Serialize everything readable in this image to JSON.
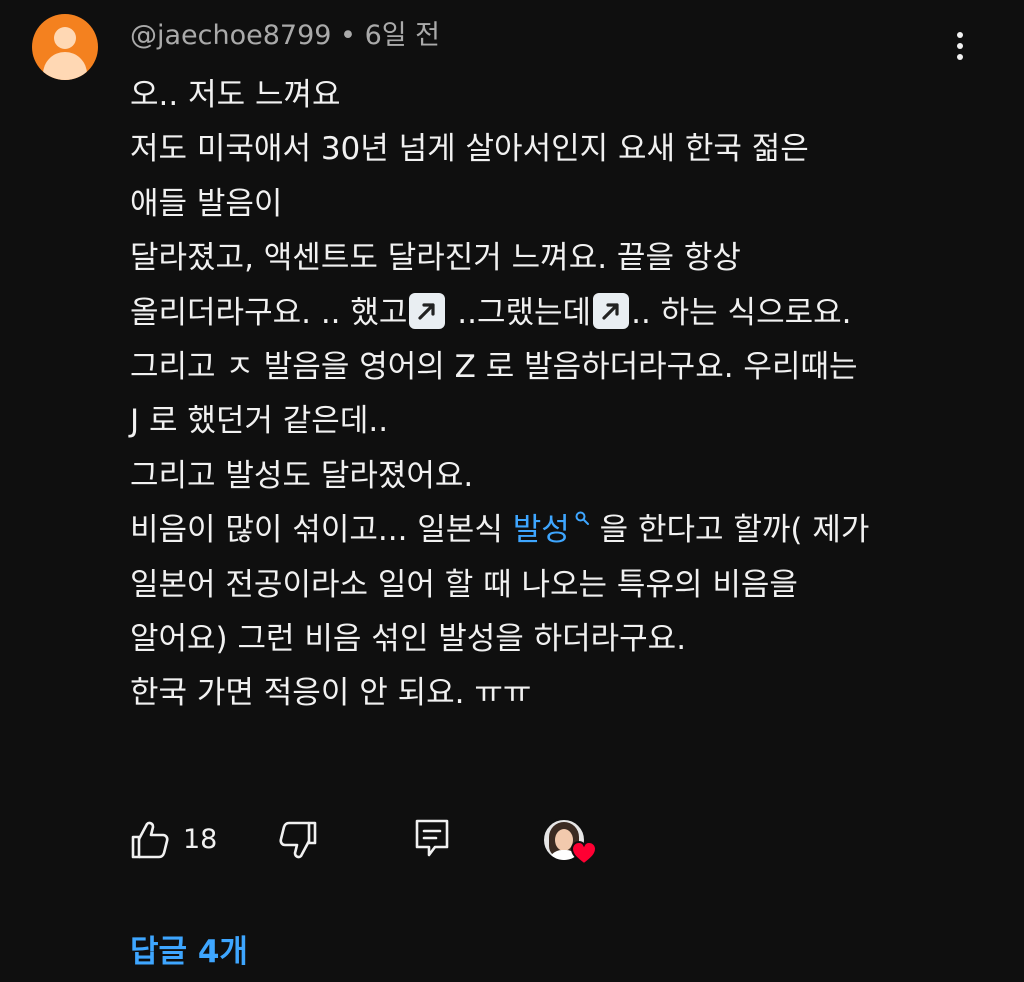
{
  "comment": {
    "author": "@jaechoe8799",
    "separator": " • ",
    "time": "6일 전",
    "lines": [
      "오.. 저도 느껴요",
      "저도 미국애서 30년 넘게 살아서인지 요새 한국 젊은",
      "애들 발음이",
      "달라졌고, 액센트도 달라진거 느껴요. 끝을 항상"
    ],
    "line5_part1": "올리더라구요. .. 했고",
    "line5_part2": " ..그랬는데",
    "line5_part3": ".. 하는 식으로요.",
    "lines_b": [
      "그리고 ㅈ 발음을 영어의 Z 로 발음하더라구요. 우리때는",
      "J 로 했던거 같은데..",
      "그리고 발성도 달라졌어요."
    ],
    "line9_before": "비음이 많이 섞이고... 일본식 ",
    "line9_link": "발성",
    "line9_after": " 을 한다고 할까( 제가",
    "lines_c": [
      "일본어 전공이라소 일어 할 때 나오는 특유의 비음을",
      "알어요) 그런 비음 섞인 발성을 하더라구요.",
      "한국 가면 적응이 안 되요. ㅠㅠ"
    ]
  },
  "actions": {
    "like_count": "18"
  },
  "replies_label": "답글 4개",
  "colors": {
    "background": "#0f0f0f",
    "text": "#f1f1f1",
    "meta": "#aaaaaa",
    "link": "#3ea6ff",
    "avatar": "#f4811f",
    "heart": "#ff0033"
  },
  "icons": {
    "avatar": "default-user-avatar",
    "more": "more-vert-icon",
    "emoji": "up-right-arrow-emoji",
    "search": "search-icon",
    "like": "thumbs-up-icon",
    "dislike": "thumbs-down-icon",
    "reply": "comment-icon",
    "creator_heart": "creator-heart-badge"
  }
}
